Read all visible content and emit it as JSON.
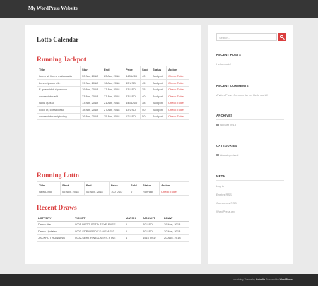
{
  "site": {
    "title": "My WordPress Website"
  },
  "page": {
    "title": "Lotto Calendar"
  },
  "sections": {
    "jackpot": "Running Jackpot",
    "lotto": "Running Lotto",
    "draws": "Recent Draws"
  },
  "jackpot_table": {
    "headers": [
      "Title",
      "Start",
      "End",
      "Price",
      "Sold",
      "Status",
      "Action"
    ],
    "rows": [
      [
        "lorem sit libero malesuada",
        "30 Apr, 2018",
        "23 Apr, 2018",
        "443 USD",
        "40",
        "Jackpot",
        "Check Ticket"
      ],
      [
        "Lorem ipsum elit.",
        "19 Apr, 2018",
        "16 Apr, 2018",
        "43 USD",
        "45",
        "Jackpot",
        "Check Ticket"
      ],
      [
        "E quam id dui posuere",
        "19 Apr, 2018",
        "17 Apr, 2018",
        "43 USD",
        "35",
        "Jackpot",
        "Check Ticket"
      ],
      [
        "consectetur elit.",
        "23 Apr, 2018",
        "27 Apr, 2018",
        "43 USD",
        "40",
        "Jackpot",
        "Check Ticket"
      ],
      [
        "Nulla quis ut",
        "13 Apr, 2018",
        "21 Apr, 2018",
        "443 USD",
        "38",
        "Jackpot",
        "Check Ticket"
      ],
      [
        "dolor ut, consectetu",
        "18 Apr, 2018",
        "27 Apr, 2018",
        "43 USD",
        "40",
        "Jackpot",
        "Check Ticket"
      ],
      [
        "consectetur adipiscing",
        "16 Apr, 2018",
        "25 Apr, 2018",
        "12 USD",
        "50",
        "Jackpot",
        "Check Ticket"
      ]
    ]
  },
  "lotto_table": {
    "headers": [
      "Title",
      "Start",
      "End",
      "Price",
      "Sold",
      "Status",
      "Action"
    ],
    "rows": [
      [
        "New Lotto",
        "05 Aug, 2018",
        "06 Aug, 2018",
        "100 USD",
        "0",
        "Running",
        "Check Ticket"
      ]
    ]
  },
  "draws_table": {
    "headers": [
      "LOTTERY",
      "TICKET",
      "MATCH",
      "AMOUNT",
      "DRAW"
    ],
    "rows": [
      [
        "Demo title",
        "0001-DRTG-SDTD-TSYE-RYSE",
        "1",
        "20 USD",
        "29 Mar, 2018"
      ],
      [
        "Demo Updated",
        "0003-SDRY-RRDY-EAYF-AE53",
        "1",
        "40 USD",
        "20 Mar, 2018"
      ],
      [
        "JACKPOT RUNNING",
        "0002-SERT-RWEA-AERS-YTAE",
        "1",
        "1516 USD",
        "20 Aug, 2018"
      ]
    ]
  },
  "sidebar": {
    "search_placeholder": "Search...",
    "recent_posts": {
      "title": "RECENT POSTS",
      "items": [
        "Hello world!"
      ]
    },
    "recent_comments": {
      "title": "RECENT COMMENTS",
      "text": "A WordPress Commenter on Hello world!"
    },
    "archives": {
      "title": "ARCHIVES",
      "items": [
        "August 2018"
      ]
    },
    "categories": {
      "title": "CATEGORIES",
      "items": [
        "Uncategorized"
      ]
    },
    "meta": {
      "title": "META",
      "items": [
        "Log in",
        "Entries RSS",
        "Comments RSS",
        "WordPress.org"
      ]
    }
  },
  "footer": {
    "prefix": "sparkling Theme by",
    "author": "Colorlib",
    "mid": "Powered by",
    "platform": "WordPress"
  },
  "colors": {
    "accent": "#da3e3e",
    "topbar": "#363636",
    "footer": "#2b2b2b"
  },
  "icons": {
    "search": "search-icon",
    "archive": "calendar-icon",
    "category": "folder-icon"
  }
}
